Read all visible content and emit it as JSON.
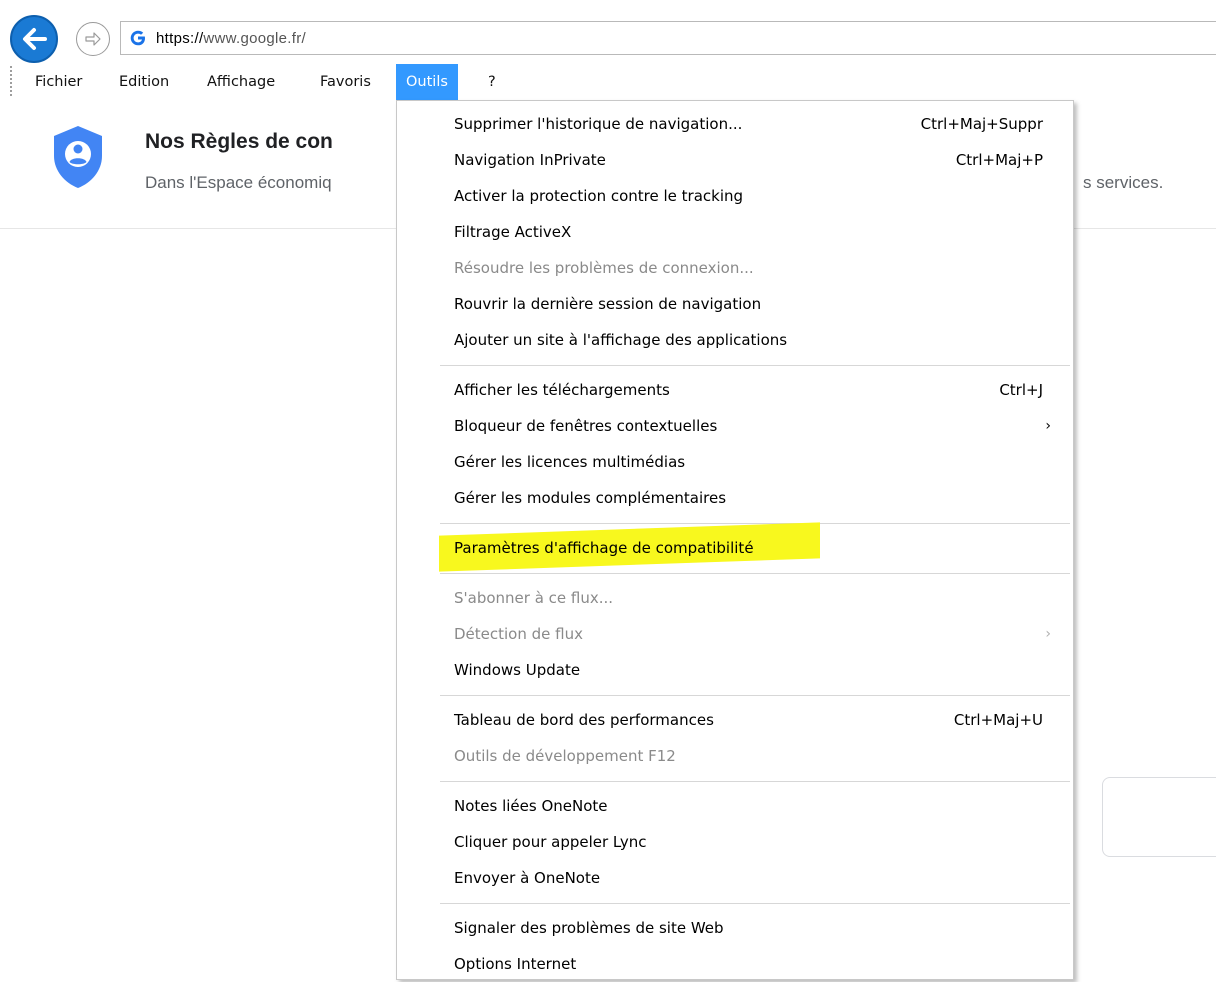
{
  "address_bar": {
    "url_scheme": "https://",
    "url_rest": "www.google.fr/"
  },
  "menubar": {
    "items": [
      "Fichier",
      "Edition",
      "Affichage",
      "Favoris",
      "Outils",
      "?"
    ],
    "active": "Outils"
  },
  "page": {
    "banner_title": "Nos Règles de con",
    "banner_text": "Dans l'Espace économiq",
    "banner_text_right": "s services."
  },
  "tools_menu": {
    "items": [
      {
        "label": "Supprimer l'historique de navigation...",
        "shortcut": "Ctrl+Maj+Suppr"
      },
      {
        "label": "Navigation InPrivate",
        "shortcut": "Ctrl+Maj+P"
      },
      {
        "label": "Activer la protection contre le tracking"
      },
      {
        "label": "Filtrage ActiveX"
      },
      {
        "label": "Résoudre les problèmes de connexion...",
        "disabled": true
      },
      {
        "label": "Rouvrir la dernière session de navigation"
      },
      {
        "label": "Ajouter un site à l'affichage des applications"
      },
      {
        "label": "Afficher les téléchargements",
        "shortcut": "Ctrl+J"
      },
      {
        "label": "Bloqueur de fenêtres contextuelles",
        "submenu": true
      },
      {
        "label": "Gérer les licences multimédias"
      },
      {
        "label": "Gérer les modules complémentaires"
      },
      {
        "label": "Paramètres d'affichage de compatibilité",
        "highlighted": true
      },
      {
        "label": "S'abonner à ce flux...",
        "disabled": true
      },
      {
        "label": "Détection de flux",
        "disabled": true,
        "submenu": true
      },
      {
        "label": "Windows Update"
      },
      {
        "label": "Tableau de bord des performances",
        "shortcut": "Ctrl+Maj+U"
      },
      {
        "label": "Outils de développement F12",
        "disabled": true
      },
      {
        "label": "Notes liées OneNote"
      },
      {
        "label": "Cliquer pour appeler Lync"
      },
      {
        "label": "Envoyer à OneNote"
      },
      {
        "label": "Signaler des problèmes de site Web"
      },
      {
        "label": "Options Internet"
      }
    ]
  },
  "colors": {
    "menu_active": "#3399ff",
    "highlight": "#f8f81e",
    "back_button": "#1a7ad4",
    "shield": "#4285f4",
    "disabled_text": "#8a8a8a"
  },
  "icons": [
    "back-arrow-icon",
    "forward-arrow-icon",
    "google-g-icon",
    "shield-user-icon",
    "submenu-chevron-icon"
  ]
}
